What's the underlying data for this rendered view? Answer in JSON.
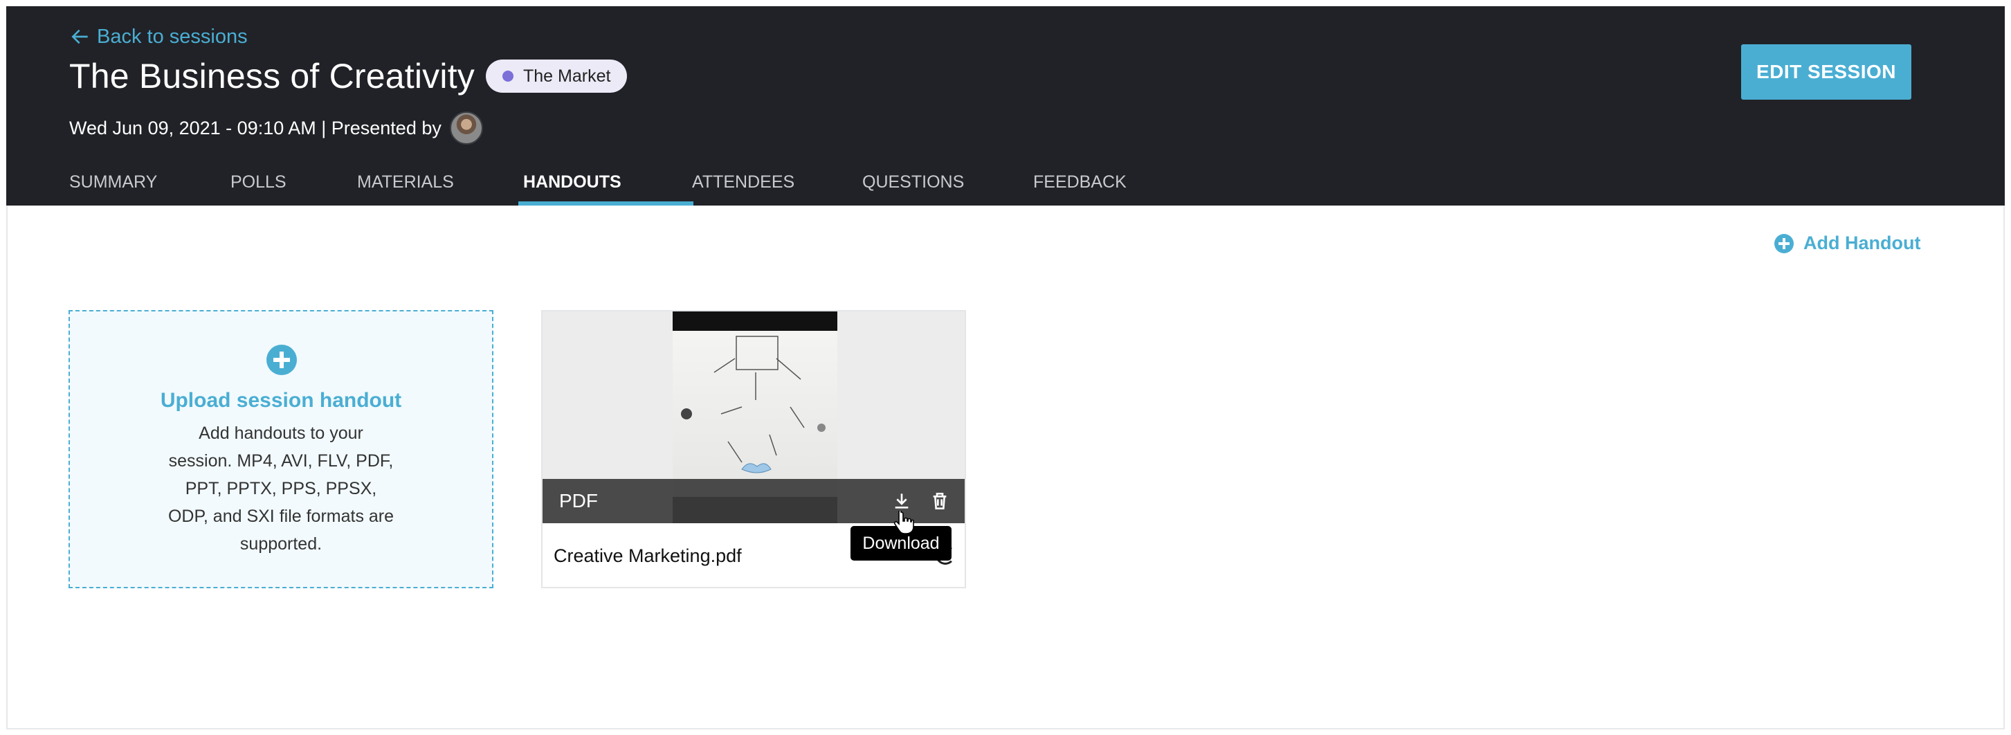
{
  "header": {
    "back_label": "Back to sessions",
    "title": "The Business of Creativity",
    "badge_label": "The Market",
    "badge_color": "#7b6fd8",
    "meta": "Wed Jun 09, 2021 - 09:10 AM | Presented by",
    "edit_button": "EDIT SESSION"
  },
  "tabs": [
    {
      "label": "SUMMARY",
      "active": false
    },
    {
      "label": "POLLS",
      "active": false
    },
    {
      "label": "MATERIALS",
      "active": false
    },
    {
      "label": "HANDOUTS",
      "active": true
    },
    {
      "label": "ATTENDEES",
      "active": false
    },
    {
      "label": "QUESTIONS",
      "active": false
    },
    {
      "label": "FEEDBACK",
      "active": false
    }
  ],
  "main": {
    "add_handout": "Add Handout",
    "upload": {
      "title": "Upload session handout",
      "description": "Add handouts to your session. MP4, AVI, FLV, PDF, PPT, PPTX, PPS, PPSX, ODP, and SXI file formats are supported."
    },
    "file": {
      "type": "PDF",
      "name": "Creative Marketing.pdf",
      "tooltip": "Download"
    }
  },
  "colors": {
    "accent": "#4aaed3",
    "header_bg": "#212227"
  }
}
